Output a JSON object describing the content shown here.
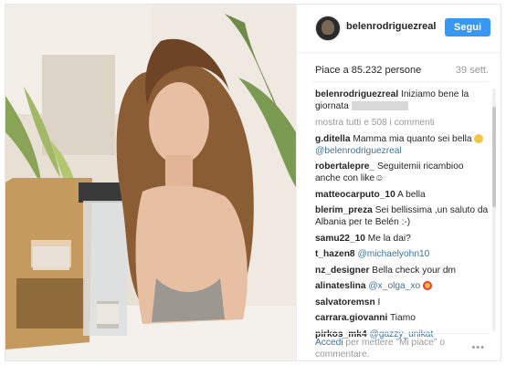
{
  "post": {
    "username": "belenrodriguezreal",
    "follow_label": "Segui",
    "likes": "Piace a 85.232 persone",
    "date": "39 sett.",
    "show_all": "mostra tutti e 508 i commenti"
  },
  "comments": [
    {
      "user": "belenrodriguezreal",
      "text": "Iniziamo bene la giornata"
    },
    {
      "user": "g.ditella",
      "text": "Mamma mia quanto sei bella",
      "mention": "@belenrodriguezreal"
    },
    {
      "user": "robertalepre_",
      "text": "Seguitemii ricambioo anche con like☺"
    },
    {
      "user": "matteocarputo_10",
      "text": "A bella"
    },
    {
      "user": "blerim_preza",
      "text": "Sei bellissima ,un saluto da Albania per te Belén :-)"
    },
    {
      "user": "samu22_10",
      "text": "Me la dai?"
    },
    {
      "user": "t_hazen8",
      "mention": "@michaelyohn10"
    },
    {
      "user": "nz_designer",
      "text": "Bella check your dm"
    },
    {
      "user": "alinateslina",
      "mention": "@x_olga_xo"
    },
    {
      "user": "salvatoremsn",
      "text": "I"
    },
    {
      "user": "carrara.giovanni",
      "text": "Tiamo"
    },
    {
      "user": "pirkos_mk4",
      "mention": "@gazzy_unikat"
    }
  ],
  "footer": {
    "login_link": "Accedi",
    "login_text": "per mettere \"Mi piace\" o commentare.",
    "more_icon": "ellipsis-icon"
  },
  "colors": {
    "accent": "#3897f0",
    "link": "#3f729b"
  }
}
